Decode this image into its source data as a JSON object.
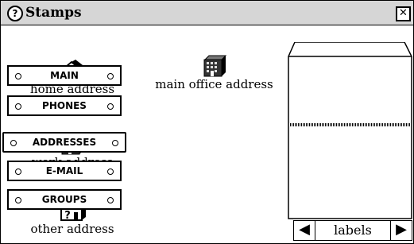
{
  "window": {
    "title": "Stamps",
    "help_icon": "?",
    "close_icon": "✕"
  },
  "addresses": [
    {
      "label": "home address",
      "icon": "house-icon"
    },
    {
      "label": "main office address",
      "icon": "office-building-icon"
    },
    {
      "label": "work address",
      "icon": "office-building-icon"
    },
    {
      "label": "other address",
      "icon": "house-question-icon"
    }
  ],
  "tabs": [
    {
      "label": "MAIN"
    },
    {
      "label": "PHONES"
    },
    {
      "label": "ADDRESSES",
      "selected": true
    },
    {
      "label": "E-MAIL"
    },
    {
      "label": "GROUPS"
    }
  ],
  "navigation": {
    "left_arrow": "◀",
    "center_label": "labels",
    "right_arrow": "▶"
  }
}
